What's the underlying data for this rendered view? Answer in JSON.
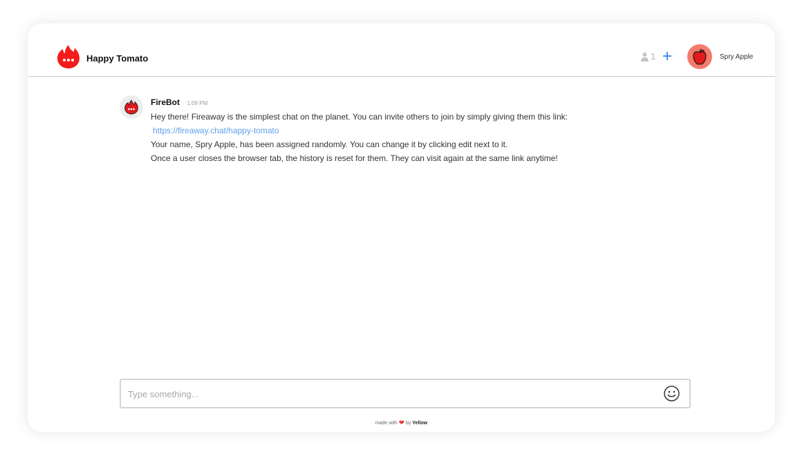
{
  "header": {
    "room_name": "Happy Tomato",
    "user_count": "1",
    "add_symbol": "+",
    "username": "Spry Apple"
  },
  "colors": {
    "brand": "#f41c1c",
    "accent": "#2f80ed",
    "link": "#5ea0e8",
    "avatar_bg": "#f47b6e"
  },
  "icons": {
    "logo": "fire-chat-icon",
    "users": "person-icon",
    "add": "plus-icon",
    "avatar": "apple-icon",
    "emoji": "smiley-icon"
  },
  "messages": [
    {
      "sender": "FireBot",
      "time": "1:09 PM",
      "line1": "Hey there! Fireaway is the simplest chat on the planet. You can invite others to join by simply giving them this link:",
      "link": "https://fireaway.chat/happy-tomato",
      "line2": "Your name, Spry Apple, has been assigned randomly. You can change it by clicking edit next to it.",
      "line3": "Once a user closes the browser tab, the history is reset for them. They can visit again at the same link anytime!"
    }
  ],
  "composer": {
    "placeholder": "Type something...",
    "value": ""
  },
  "footer": {
    "made_with": "made with",
    "by": "by",
    "brand": "Yellow"
  }
}
